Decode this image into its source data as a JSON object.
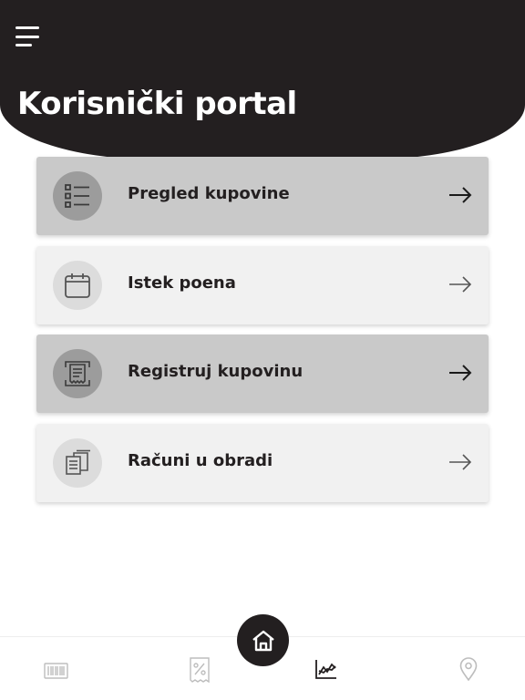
{
  "header": {
    "title": "Korisnički portal"
  },
  "menu": [
    {
      "label": "Pregled kupovine",
      "icon": "list-icon"
    },
    {
      "label": "Istek poena",
      "icon": "calendar-icon"
    },
    {
      "label": "Registruj kupovinu",
      "icon": "receipt-icon"
    },
    {
      "label": "Računi u obradi",
      "icon": "documents-icon"
    }
  ],
  "bottom_nav": {
    "items": [
      "barcode-icon",
      "discount-tag-icon",
      "home-icon",
      "chart-icon",
      "location-pin-icon"
    ]
  },
  "colors": {
    "header_bg": "#231f20",
    "card_highlight": "#c9c9c9",
    "card_normal": "#f1f1f1"
  }
}
